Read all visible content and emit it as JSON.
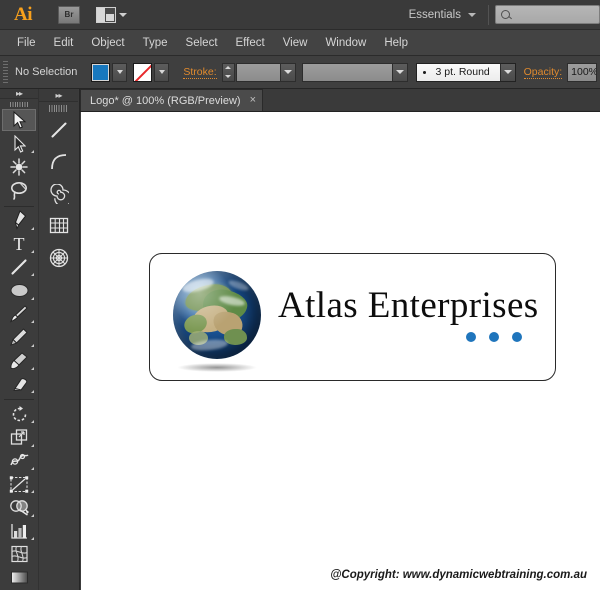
{
  "app": {
    "name": "Ai",
    "bridge_label": "Br",
    "arrange_icon": "arrange-documents-icon",
    "workspace": "Essentials",
    "search_placeholder": ""
  },
  "menubar": {
    "items": [
      {
        "label": "File"
      },
      {
        "label": "Edit"
      },
      {
        "label": "Object"
      },
      {
        "label": "Type"
      },
      {
        "label": "Select"
      },
      {
        "label": "Effect"
      },
      {
        "label": "View"
      },
      {
        "label": "Window"
      },
      {
        "label": "Help"
      }
    ]
  },
  "controlbar": {
    "selection_status": "No Selection",
    "fill_color": "#1878be",
    "stroke_color": "none",
    "stroke_label": "Stroke:",
    "stroke_weight": "",
    "stroke_profile": "",
    "brush_preset": "3 pt. Round",
    "opacity_label": "Opacity:",
    "opacity_value": "100%"
  },
  "document": {
    "tab_title": "Logo* @ 100% (RGB/Preview)",
    "close_label": "×"
  },
  "toolbar": {
    "column_left": [
      {
        "name": "selection-tool",
        "active": true
      },
      {
        "name": "direct-selection-tool",
        "active": false
      },
      {
        "name": "magic-wand-tool",
        "active": false
      },
      {
        "name": "lasso-tool",
        "active": false
      },
      {
        "name": "pen-tool",
        "active": false
      },
      {
        "name": "type-tool",
        "active": false
      },
      {
        "name": "line-segment-tool",
        "active": false
      },
      {
        "name": "ellipse-tool",
        "active": false
      },
      {
        "name": "paintbrush-tool",
        "active": false
      },
      {
        "name": "pencil-tool",
        "active": false
      },
      {
        "name": "blob-brush-tool",
        "active": false
      },
      {
        "name": "eraser-tool",
        "active": false
      },
      {
        "name": "rotate-tool",
        "active": false
      },
      {
        "name": "scale-tool",
        "active": false
      },
      {
        "name": "width-tool",
        "active": false
      },
      {
        "name": "free-transform-tool",
        "active": false
      },
      {
        "name": "shape-builder-tool",
        "active": false
      },
      {
        "name": "column-graph-tool",
        "active": false
      },
      {
        "name": "mesh-tool",
        "active": false
      },
      {
        "name": "gradient-tool",
        "active": false
      }
    ],
    "column_right": [
      {
        "name": "line-tool",
        "active": false
      },
      {
        "name": "arc-tool",
        "active": false
      },
      {
        "name": "spiral-tool",
        "active": false
      },
      {
        "name": "rectangular-grid-tool",
        "active": false
      },
      {
        "name": "polar-grid-tool",
        "active": false
      }
    ]
  },
  "artwork": {
    "company_name": "Atlas Enterprises",
    "dot_color": "#1f75bc",
    "dot_count": 3,
    "globe_alt": "earth-globe-graphic"
  },
  "footer": {
    "copyright": "@Copyright: www.dynamicwebtraining.com.au"
  }
}
